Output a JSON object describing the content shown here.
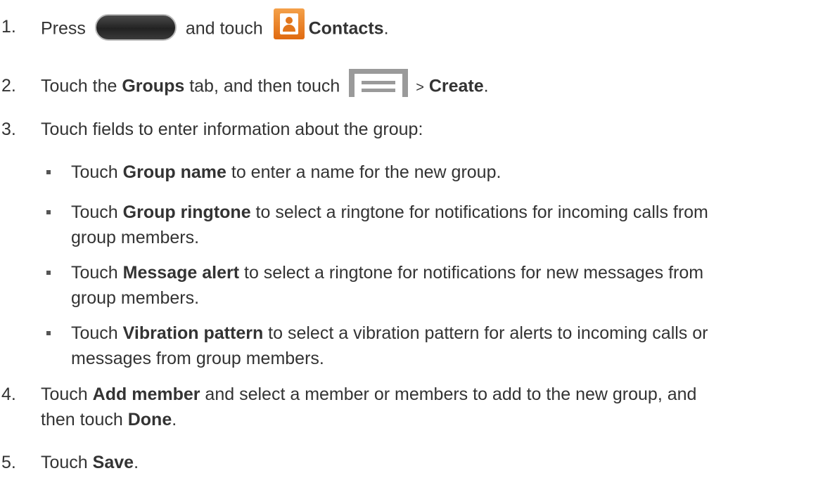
{
  "steps": [
    {
      "num": "1.",
      "a": "Press",
      "b": "and touch",
      "c": "Contacts",
      "d": "."
    },
    {
      "num": "2.",
      "a": "Touch the ",
      "b": "Groups",
      "c": " tab, and then touch",
      "d": ">",
      "e": "Create",
      "f": "."
    },
    {
      "num": "3.",
      "text": "Touch fields to enter information about the group:"
    },
    {
      "num": "4.",
      "a": "Touch ",
      "b": "Add member",
      "c": " and select a member or members to add to the new group, and",
      "d": "then touch ",
      "e": "Done",
      "f": "."
    },
    {
      "num": "5.",
      "a": "Touch ",
      "b": "Save",
      "c": "."
    }
  ],
  "bullets": [
    {
      "a": "Touch ",
      "b": "Group name",
      "c": " to enter a name for the new group."
    },
    {
      "a": "Touch ",
      "b": "Group ringtone",
      "c": " to select a ringtone for notifications for incoming calls from",
      "d": "group members."
    },
    {
      "a": "Touch ",
      "b": "Message alert",
      "c": " to select a ringtone for notifications for new messages from",
      "d": "group members."
    },
    {
      "a": "Touch ",
      "b": "Vibration pattern",
      "c": " to select a vibration pattern for alerts to incoming calls or",
      "d": "messages from group members."
    }
  ],
  "icons": {
    "home_key": "home-key-icon",
    "contacts": "contacts-icon",
    "menu_key": "menu-key-icon"
  },
  "colors": {
    "text": "#333333",
    "contacts_icon": "#e87a1e",
    "menu_icon": "#9a9a9a"
  }
}
